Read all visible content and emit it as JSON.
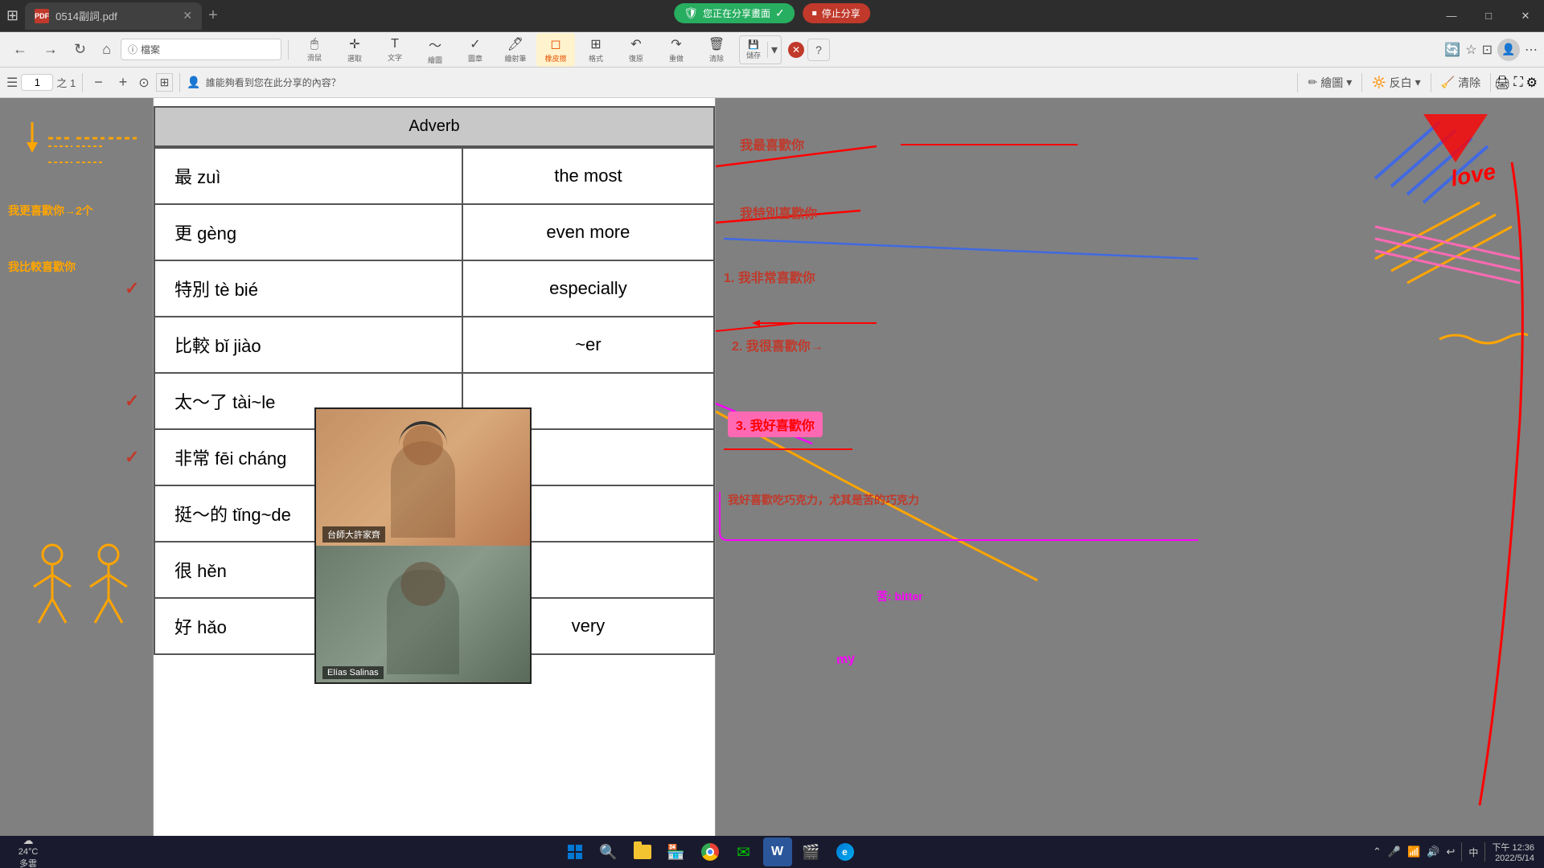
{
  "browser": {
    "tab_title": "0514副詞.pdf",
    "tab_icon": "pdf",
    "sharing_banner": "您正在分享畫面",
    "stop_sharing": "停止分享",
    "window_minimize": "—",
    "window_maximize": "□",
    "window_close": "✕"
  },
  "toolbar": {
    "tools": [
      {
        "label": "滑鼠",
        "icon": "🖱"
      },
      {
        "label": "選取",
        "icon": "✛"
      },
      {
        "label": "文字",
        "icon": "T"
      },
      {
        "label": "繪圖",
        "icon": "〜"
      },
      {
        "label": "圖章",
        "icon": "✓"
      },
      {
        "label": "繪射筆",
        "icon": "🖊"
      },
      {
        "label": "橡皮擦",
        "icon": "◻"
      },
      {
        "label": "格式",
        "icon": "⊞"
      },
      {
        "label": "復原",
        "icon": "↶"
      },
      {
        "label": "重做",
        "icon": "↷"
      },
      {
        "label": "清除",
        "icon": "🗑"
      },
      {
        "label": "儲存",
        "icon": "💾"
      }
    ],
    "page_current": "1",
    "page_total": "之 1",
    "share_info": "誰能夠看到您在此分享的內容？",
    "right_tools": [
      {
        "label": "繪圖",
        "icon": "✏"
      },
      {
        "label": "反白",
        "icon": "🔆"
      },
      {
        "label": "清除",
        "icon": "🧹"
      }
    ]
  },
  "vocab_table": {
    "header": "Adverb",
    "rows": [
      {
        "chinese": "最 zuì",
        "english": "the most",
        "has_check": false
      },
      {
        "chinese": "更 gèng",
        "english": "even more",
        "has_check": false
      },
      {
        "chinese": "特別 tè bié",
        "english": "especially",
        "has_check": true
      },
      {
        "chinese": "比較 bǐ jiào",
        "english": "~er",
        "has_check": false
      },
      {
        "chinese": "太～了 tài~le",
        "english": "",
        "has_check": true
      },
      {
        "chinese": "非常 fēi cháng",
        "english": "",
        "has_check": true
      },
      {
        "chinese": "挺～的 tǐng~de",
        "english": "",
        "has_check": false
      },
      {
        "chinese": "很 hěn",
        "english": "",
        "has_check": false
      },
      {
        "chinese": "好 hǎo",
        "english": "very",
        "has_check": false
      }
    ]
  },
  "webcam": {
    "person1_label": "台師大許家齊",
    "person2_label": "Elías Salinas"
  },
  "annotations": {
    "left": [
      "我更喜歡你→2个",
      "我比較喜歡你"
    ],
    "right": [
      "我最喜歡你",
      "我特別喜歡你",
      "1. 我非常喜歡你",
      "2. 我很喜歡你→",
      "3. 我好喜歡你",
      "我好喜歡吃巧克力，尤其是苦的巧克力",
      "苦: bitter",
      "my"
    ]
  },
  "taskbar": {
    "weather_temp": "24°C",
    "weather_desc": "多雲",
    "time": "下午 12:36",
    "date": "2022/5/14",
    "icons": [
      "⊞",
      "🔍",
      "📁",
      "🌐",
      "🌀",
      "🌐",
      "✉",
      "W",
      "🎬",
      "🌐"
    ]
  },
  "love_text": "love"
}
